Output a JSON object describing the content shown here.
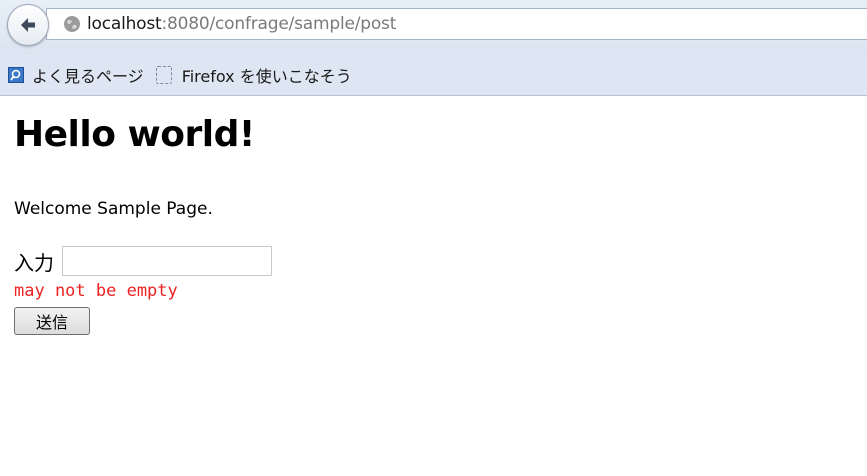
{
  "browser": {
    "url_host": "localhost",
    "url_rest": ":8080/confrage/sample/post",
    "back_icon": "back-arrow-icon",
    "site_icon": "globe-icon",
    "bookmarks": [
      {
        "label": "よく見るページ",
        "icon": "most-visited-icon"
      },
      {
        "label": "Firefox を使いこなそう",
        "icon": "placeholder-page-icon"
      }
    ]
  },
  "page": {
    "title": "Hello world!",
    "welcome": "Welcome Sample Page.",
    "form": {
      "input_label": "入力",
      "input_value": "",
      "input_placeholder": "",
      "error_message": "may not be empty",
      "submit_label": "送信"
    }
  },
  "colors": {
    "error": "#ee2222",
    "chrome_background": "#dde6f2"
  }
}
